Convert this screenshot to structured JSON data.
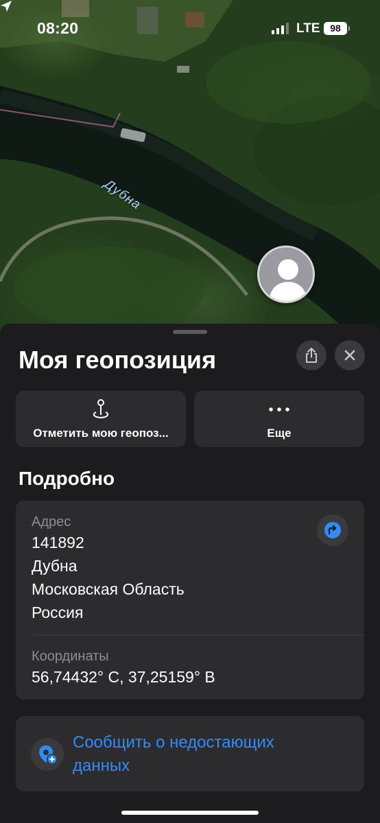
{
  "status_bar": {
    "time": "08:20",
    "network": "LTE",
    "battery": "98"
  },
  "map": {
    "river_label": "Дубна"
  },
  "sheet": {
    "title": "Моя геопозиция",
    "actions": [
      {
        "label": "Отметить мою геопоз...",
        "icon": "mark-location-icon"
      },
      {
        "label": "Еще",
        "icon": "more-icon"
      }
    ],
    "section_title": "Подробно",
    "address": {
      "label": "Адрес",
      "lines": [
        "141892",
        "Дубна",
        "Московская Область",
        "Россия"
      ]
    },
    "coordinates": {
      "label": "Координаты",
      "value": "56,74432° С, 37,25159° В"
    },
    "report": {
      "line1": "Сообщить о недостающих",
      "line2": "данных"
    }
  },
  "colors": {
    "accent": "#2f8cff",
    "sheet_bg": "#1c1c1e",
    "card_bg": "#2c2c2e"
  }
}
